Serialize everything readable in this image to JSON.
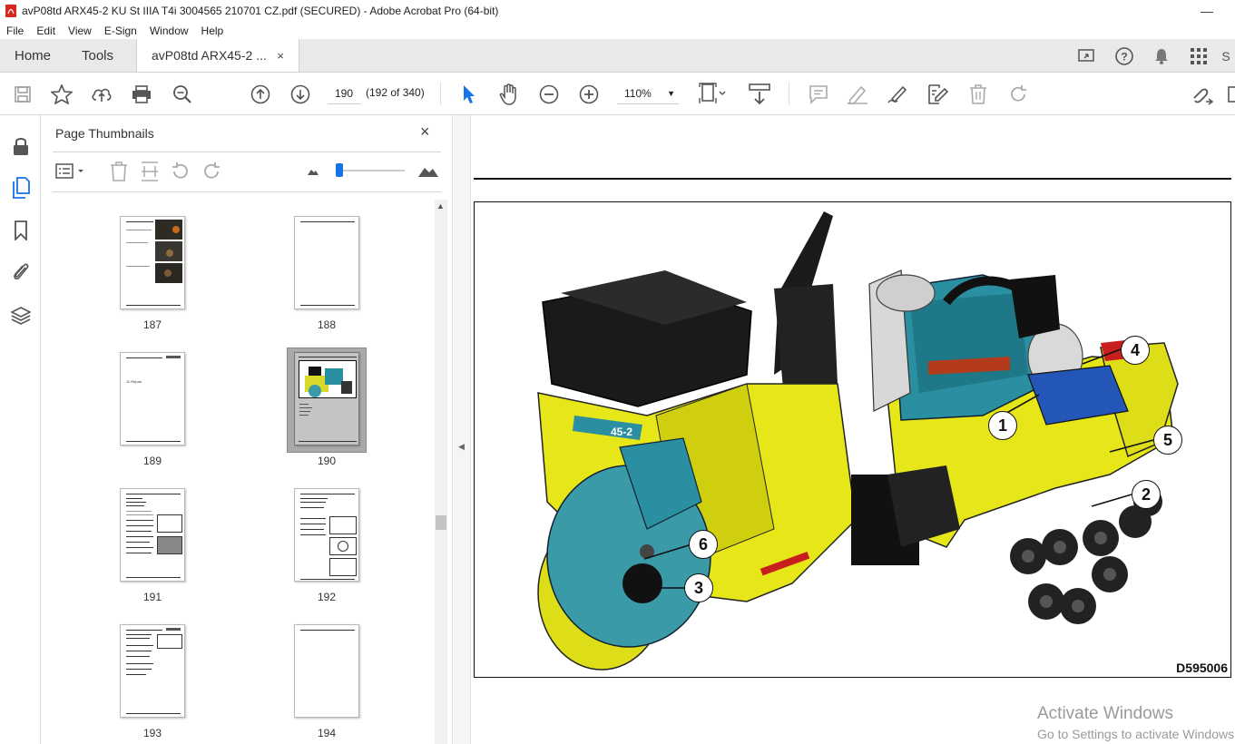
{
  "window": {
    "title": "avP08td ARX45-2 KU St IIIA T4i 3004565 210701 CZ.pdf (SECURED) - Adobe Acrobat Pro (64-bit)"
  },
  "menu": [
    "File",
    "Edit",
    "View",
    "E-Sign",
    "Window",
    "Help"
  ],
  "tabs": {
    "home": "Home",
    "tools": "Tools",
    "document": "avP08td ARX45-2 ...",
    "close": "×"
  },
  "toolbar": {
    "page_number": "190",
    "page_count": "(192 of 340)",
    "zoom": "110%"
  },
  "thumbnails_panel": {
    "title": "Page Thumbnails",
    "close": "×",
    "pages": [
      {
        "label": "187"
      },
      {
        "label": "188"
      },
      {
        "label": "189",
        "heading": "11 Repair"
      },
      {
        "label": "190",
        "selected": true
      },
      {
        "label": "191"
      },
      {
        "label": "192"
      },
      {
        "label": "193"
      },
      {
        "label": "194"
      }
    ]
  },
  "figure": {
    "code": "D595006",
    "model_badge": "45-2",
    "callouts": [
      "1",
      "2",
      "3",
      "4",
      "5",
      "6"
    ]
  },
  "watermark": {
    "line1": "Activate Windows",
    "line2": "Go to Settings to activate Windows."
  },
  "colors": {
    "accent": "#1473e6",
    "machine_yellow": "#e6e619",
    "engine_teal": "#2a8fa0",
    "acrobat_red": "#d7261e"
  }
}
